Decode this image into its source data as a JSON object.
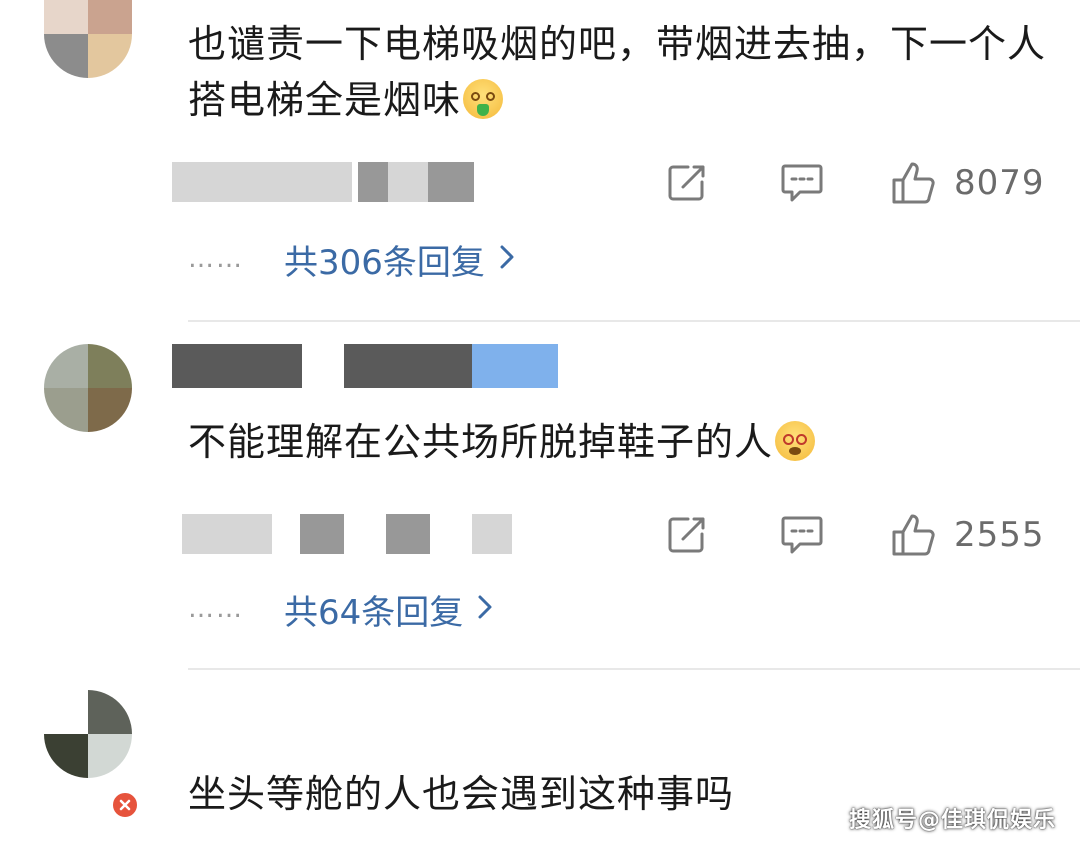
{
  "comments": [
    {
      "text": "也谴责一下电梯吸烟的吧，带烟进去抽，下一个人搭电梯全是烟味",
      "emoji": "vomiting-face-emoji",
      "likes": "8079",
      "reply_label": "共306条回复",
      "dots": "……"
    },
    {
      "text": "不能理解在公共场所脱掉鞋子的人",
      "emoji": "dizzy-face-emoji",
      "likes": "2555",
      "reply_label": "共64条回复",
      "dots": "……"
    },
    {
      "text": "坐头等舱的人也会遇到这种事吗"
    }
  ],
  "icons": {
    "share": "share-icon",
    "comment": "comment-icon",
    "like": "thumbs-up-icon",
    "chevron": "chevron-right-icon"
  },
  "colors": {
    "reply_link": "#3b6aa5",
    "meta_gray": "#7a7a7a"
  },
  "watermark": "搜狐号@佳琪侃娱乐"
}
